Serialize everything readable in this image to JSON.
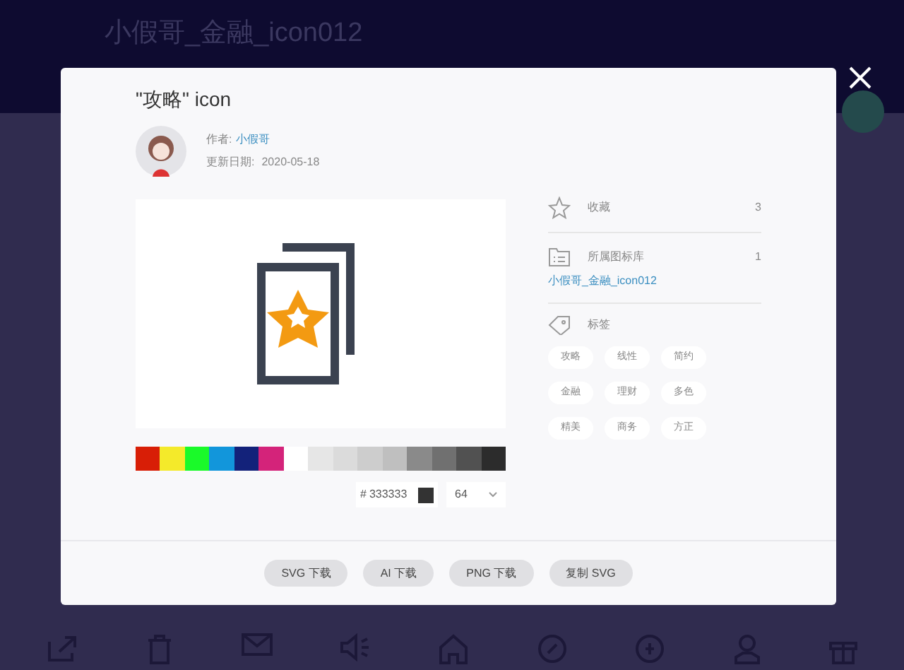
{
  "background": {
    "title": "小假哥_金融_icon012"
  },
  "dialog": {
    "title": "\"攻略\" icon",
    "author_label": "作者:",
    "author": "小假哥",
    "date_label": "更新日期:",
    "date": "2020-05-18",
    "palette": [
      {
        "color": "#d81e06"
      },
      {
        "color": "#f4ea2a"
      },
      {
        "color": "#1afa29"
      },
      {
        "color": "#1296db"
      },
      {
        "color": "#13227a"
      },
      {
        "color": "#d4237a"
      },
      {
        "color": "#ffffff"
      },
      {
        "color": "#e6e6e6"
      },
      {
        "color": "#dbdbdb"
      },
      {
        "color": "#cdcdcd"
      },
      {
        "color": "#bfbfbf"
      },
      {
        "color": "#8a8a8a"
      },
      {
        "color": "#707070"
      },
      {
        "color": "#515151"
      },
      {
        "color": "#2c2c2c"
      }
    ],
    "hex_prefix": "#",
    "hex_value": "333333",
    "size": "64",
    "favorites_label": "收藏",
    "favorites_count": "3",
    "library_label": "所属图标库",
    "library_count": "1",
    "library_link": "小假哥_金融_icon012",
    "tags_label": "标签",
    "tags": [
      "攻略",
      "线性",
      "简约",
      "金融",
      "理财",
      "多色",
      "精美",
      "商务",
      "方正"
    ],
    "buttons": [
      "SVG 下载",
      "AI 下载",
      "PNG 下载",
      "复制 SVG"
    ]
  }
}
